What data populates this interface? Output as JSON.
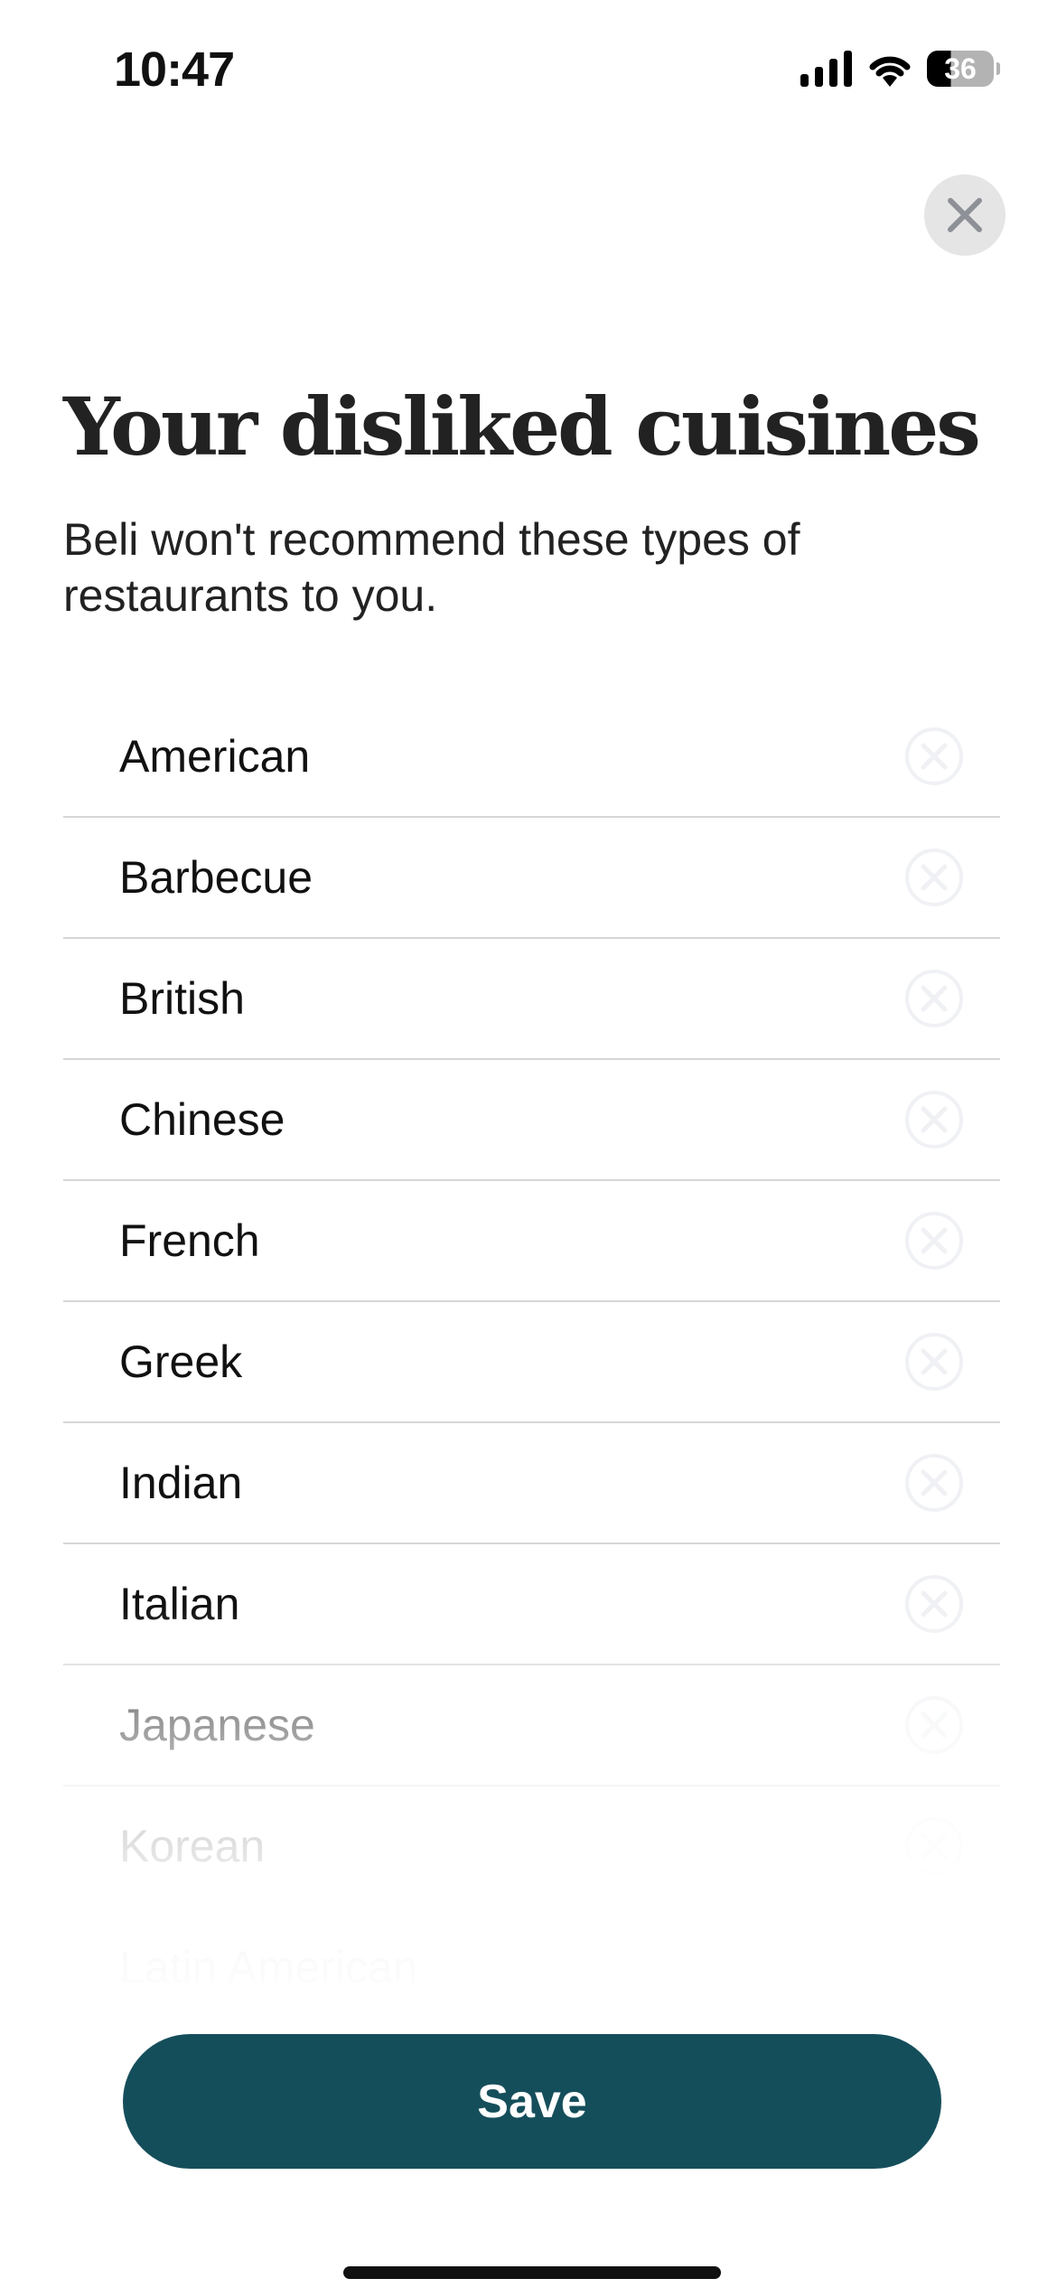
{
  "status_bar": {
    "time": "10:47",
    "battery": "36"
  },
  "header": {
    "title": "Your disliked cuisines",
    "subtitle": "Beli won't recommend these types of restaurants to you."
  },
  "cuisines": [
    "American",
    "Barbecue",
    "British",
    "Chinese",
    "French",
    "Greek",
    "Indian",
    "Italian",
    "Japanese",
    "Korean",
    "Latin American"
  ],
  "save_label": "Save",
  "colors": {
    "accent": "#154e5b",
    "remove_icon": "#f0f1f4"
  }
}
